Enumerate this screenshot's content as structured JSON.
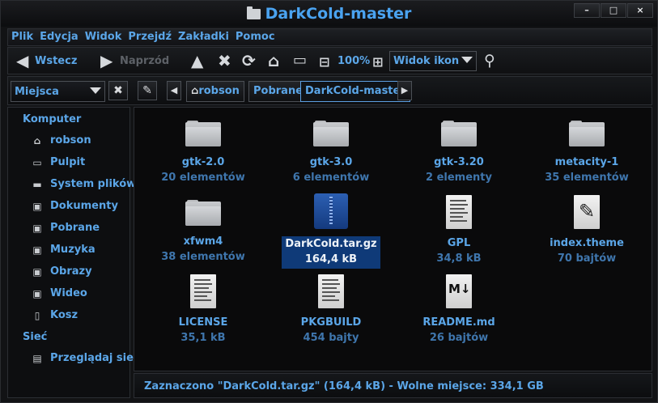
{
  "window": {
    "title": "DarkCold-master",
    "controls": [
      "–",
      "□",
      "×"
    ]
  },
  "menu": [
    "Plik",
    "Edycja",
    "Widok",
    "Przejdź",
    "Zakładki",
    "Pomoc"
  ],
  "toolbar": {
    "back_label": "Wstecz",
    "forward_label": "Naprzód",
    "zoom": "100%",
    "view_mode": "Widok ikon"
  },
  "location": {
    "places_label": "Miejsca",
    "crumbs": [
      "robson",
      "Pobrane",
      "DarkCold-master"
    ]
  },
  "sidebar": {
    "computer_header": "Komputer",
    "items": [
      "robson",
      "Pulpit",
      "System plików",
      "Dokumenty",
      "Pobrane",
      "Muzyka",
      "Obrazy",
      "Wideo",
      "Kosz"
    ],
    "network_header": "Sieć",
    "network_items": [
      "Przeglądaj sieć"
    ]
  },
  "files": [
    {
      "name": "gtk-2.0",
      "info": "20 elementów",
      "type": "folder"
    },
    {
      "name": "gtk-3.0",
      "info": "6 elementów",
      "type": "folder"
    },
    {
      "name": "gtk-3.20",
      "info": "2 elementy",
      "type": "folder"
    },
    {
      "name": "metacity-1",
      "info": "35 elementów",
      "type": "folder"
    },
    {
      "name": "xfwm4",
      "info": "38 elementów",
      "type": "folder"
    },
    {
      "name": "DarkCold.tar.gz",
      "info": "164,4 kB",
      "type": "archive",
      "selected": true
    },
    {
      "name": "GPL",
      "info": "34,8 kB",
      "type": "text"
    },
    {
      "name": "index.theme",
      "info": "70 bajtów",
      "type": "theme"
    },
    {
      "name": "LICENSE",
      "info": "35,1 kB",
      "type": "text"
    },
    {
      "name": "PKGBUILD",
      "info": "454 bajty",
      "type": "text"
    },
    {
      "name": "README.md",
      "info": "26 bajtów",
      "type": "markdown"
    }
  ],
  "status": "Zaznaczono \"DarkCold.tar.gz\" (164,4 kB) - Wolne miejsce: 334,1 GB",
  "colors": {
    "accent": "#5ba6e8",
    "selection": "#0f3a78",
    "background": "#0a0a0b"
  }
}
